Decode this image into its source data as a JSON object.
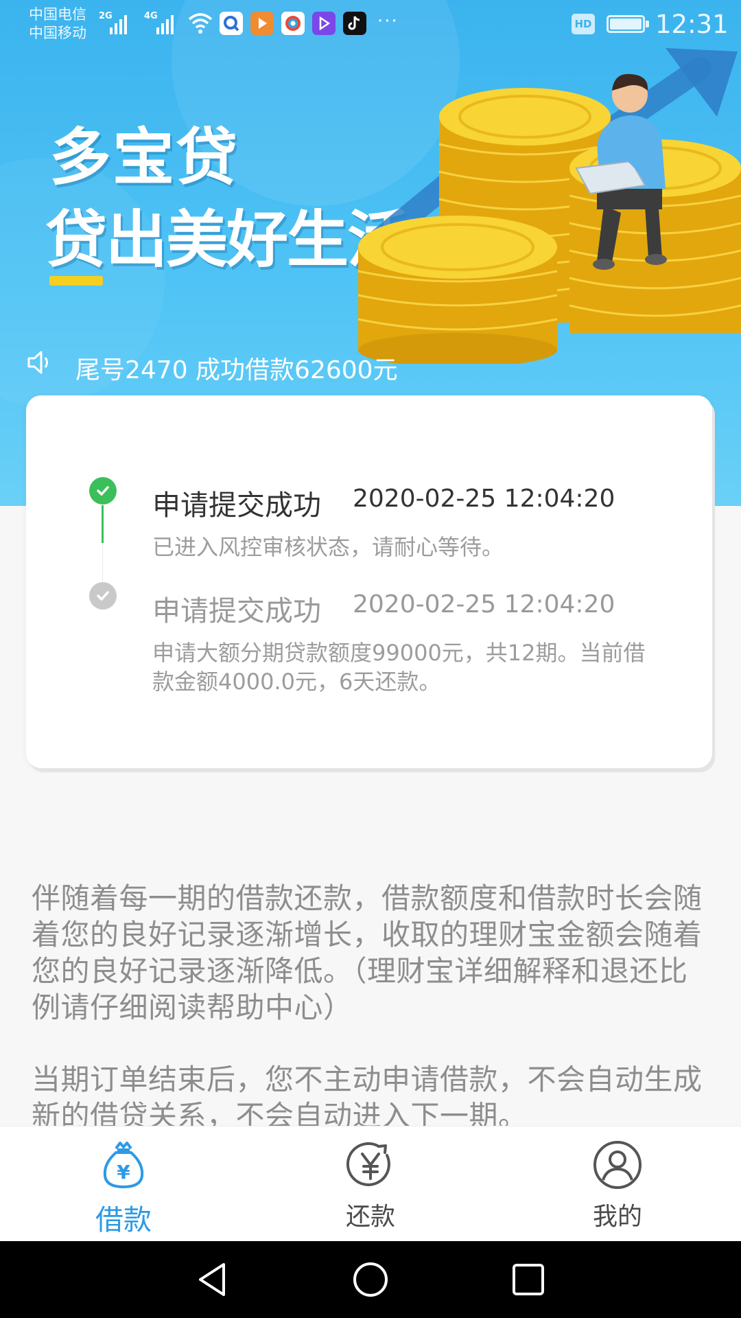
{
  "status_bar": {
    "carrier_1": "中国电信",
    "carrier_2": "中国移动",
    "network_1": "2G",
    "network_2": "4G",
    "hd_badge": "HD",
    "time": "12:31",
    "more": "···"
  },
  "banner": {
    "slogan_line1": "多宝贷",
    "slogan_line2": "贷出美好生活",
    "notice": "尾号2470 成功借款62600元"
  },
  "progress": {
    "steps": [
      {
        "title": "申请提交成功",
        "time": "2020-02-25 12:04:20",
        "desc": "已进入风控审核状态，请耐心等待。",
        "status": "done"
      },
      {
        "title": "申请提交成功",
        "time": "2020-02-25 12:04:20",
        "desc": "申请大额分期贷款额度99000元，共12期。当前借款金额4000.0元，6天还款。",
        "status": "pending"
      }
    ]
  },
  "info": {
    "paragraph_1": "伴随着每一期的借款还款，借款额度和借款时长会随着您的良好记录逐渐增长，收取的理财宝金额会随着您的良好记录逐渐降低。（理财宝详细解释和退还比例请仔细阅读帮助中心）",
    "paragraph_2": "当期订单结束后，您不主动申请借款，不会自动生成新的借贷关系，不会自动进入下一期。"
  },
  "tabs": [
    {
      "label": "借款",
      "icon": "money-bag-icon",
      "active": true
    },
    {
      "label": "还款",
      "icon": "yen-circle-icon",
      "active": false
    },
    {
      "label": "我的",
      "icon": "user-icon",
      "active": false
    }
  ],
  "colors": {
    "banner": "#3bb3ee",
    "accent": "#2d9ae6",
    "success": "#3bbf5b",
    "pending": "#c9c9c9"
  }
}
